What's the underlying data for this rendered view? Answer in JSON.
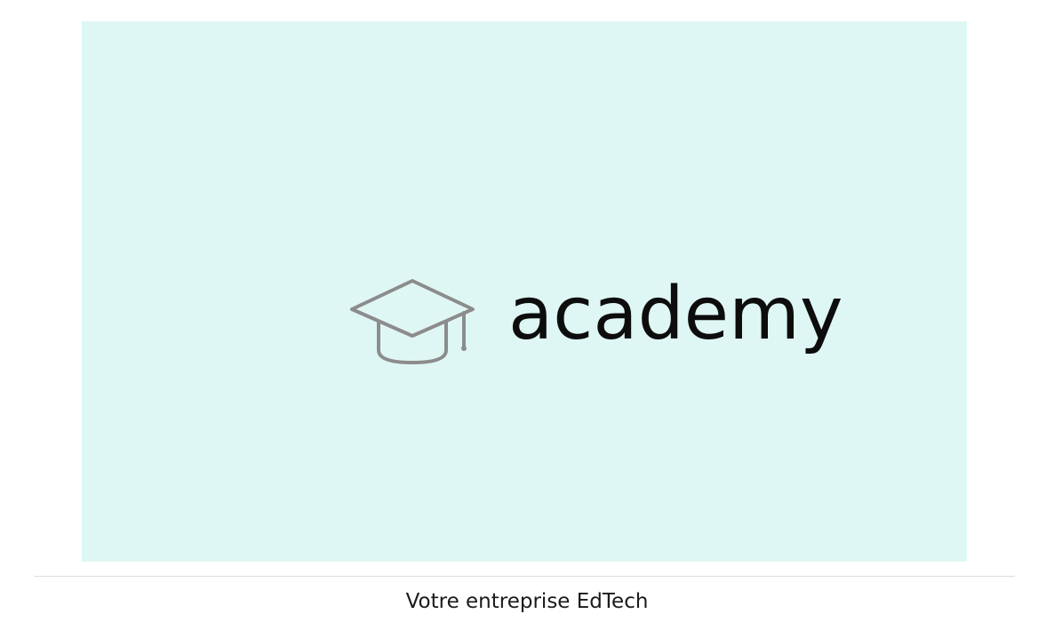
{
  "card": {
    "background_color": "#dff7f4",
    "logo": {
      "icon": "graduation-cap-icon",
      "icon_color": "#8c8c8c",
      "wordmark": "academy",
      "wordmark_color": "#0d0d0d"
    },
    "caption": "Votre entreprise EdTech"
  }
}
